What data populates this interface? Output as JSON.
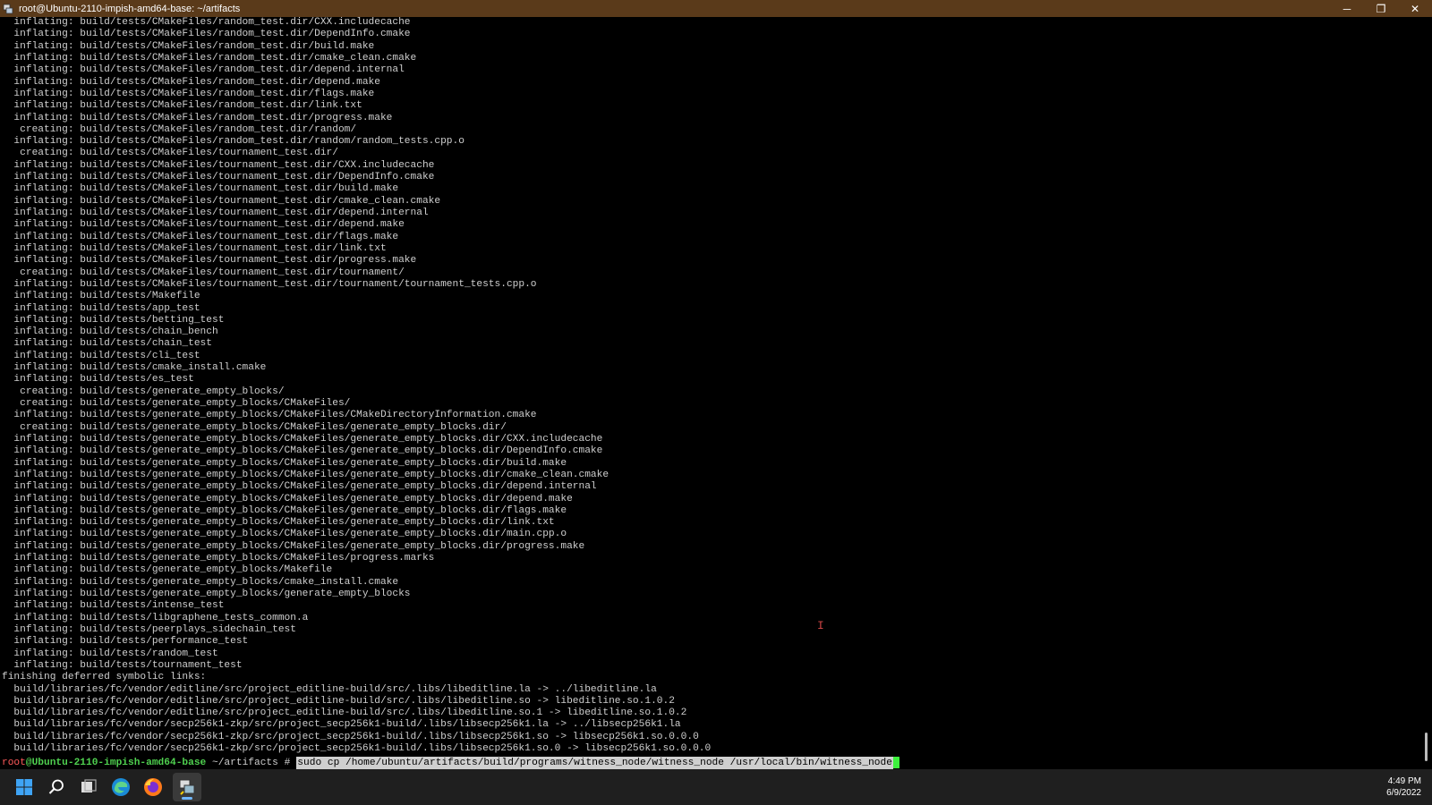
{
  "window": {
    "title": "root@Ubuntu-2110-impish-amd64-base: ~/artifacts",
    "buttons": {
      "minimize": "─",
      "maximize": "❐",
      "close": "✕"
    }
  },
  "terminal": {
    "lines": [
      "  inflating: build/tests/CMakeFiles/random_test.dir/CXX.includecache",
      "  inflating: build/tests/CMakeFiles/random_test.dir/DependInfo.cmake",
      "  inflating: build/tests/CMakeFiles/random_test.dir/build.make",
      "  inflating: build/tests/CMakeFiles/random_test.dir/cmake_clean.cmake",
      "  inflating: build/tests/CMakeFiles/random_test.dir/depend.internal",
      "  inflating: build/tests/CMakeFiles/random_test.dir/depend.make",
      "  inflating: build/tests/CMakeFiles/random_test.dir/flags.make",
      "  inflating: build/tests/CMakeFiles/random_test.dir/link.txt",
      "  inflating: build/tests/CMakeFiles/random_test.dir/progress.make",
      "   creating: build/tests/CMakeFiles/random_test.dir/random/",
      "  inflating: build/tests/CMakeFiles/random_test.dir/random/random_tests.cpp.o",
      "   creating: build/tests/CMakeFiles/tournament_test.dir/",
      "  inflating: build/tests/CMakeFiles/tournament_test.dir/CXX.includecache",
      "  inflating: build/tests/CMakeFiles/tournament_test.dir/DependInfo.cmake",
      "  inflating: build/tests/CMakeFiles/tournament_test.dir/build.make",
      "  inflating: build/tests/CMakeFiles/tournament_test.dir/cmake_clean.cmake",
      "  inflating: build/tests/CMakeFiles/tournament_test.dir/depend.internal",
      "  inflating: build/tests/CMakeFiles/tournament_test.dir/depend.make",
      "  inflating: build/tests/CMakeFiles/tournament_test.dir/flags.make",
      "  inflating: build/tests/CMakeFiles/tournament_test.dir/link.txt",
      "  inflating: build/tests/CMakeFiles/tournament_test.dir/progress.make",
      "   creating: build/tests/CMakeFiles/tournament_test.dir/tournament/",
      "  inflating: build/tests/CMakeFiles/tournament_test.dir/tournament/tournament_tests.cpp.o",
      "  inflating: build/tests/Makefile",
      "  inflating: build/tests/app_test",
      "  inflating: build/tests/betting_test",
      "  inflating: build/tests/chain_bench",
      "  inflating: build/tests/chain_test",
      "  inflating: build/tests/cli_test",
      "  inflating: build/tests/cmake_install.cmake",
      "  inflating: build/tests/es_test",
      "   creating: build/tests/generate_empty_blocks/",
      "   creating: build/tests/generate_empty_blocks/CMakeFiles/",
      "  inflating: build/tests/generate_empty_blocks/CMakeFiles/CMakeDirectoryInformation.cmake",
      "   creating: build/tests/generate_empty_blocks/CMakeFiles/generate_empty_blocks.dir/",
      "  inflating: build/tests/generate_empty_blocks/CMakeFiles/generate_empty_blocks.dir/CXX.includecache",
      "  inflating: build/tests/generate_empty_blocks/CMakeFiles/generate_empty_blocks.dir/DependInfo.cmake",
      "  inflating: build/tests/generate_empty_blocks/CMakeFiles/generate_empty_blocks.dir/build.make",
      "  inflating: build/tests/generate_empty_blocks/CMakeFiles/generate_empty_blocks.dir/cmake_clean.cmake",
      "  inflating: build/tests/generate_empty_blocks/CMakeFiles/generate_empty_blocks.dir/depend.internal",
      "  inflating: build/tests/generate_empty_blocks/CMakeFiles/generate_empty_blocks.dir/depend.make",
      "  inflating: build/tests/generate_empty_blocks/CMakeFiles/generate_empty_blocks.dir/flags.make",
      "  inflating: build/tests/generate_empty_blocks/CMakeFiles/generate_empty_blocks.dir/link.txt",
      "  inflating: build/tests/generate_empty_blocks/CMakeFiles/generate_empty_blocks.dir/main.cpp.o",
      "  inflating: build/tests/generate_empty_blocks/CMakeFiles/generate_empty_blocks.dir/progress.make",
      "  inflating: build/tests/generate_empty_blocks/CMakeFiles/progress.marks",
      "  inflating: build/tests/generate_empty_blocks/Makefile",
      "  inflating: build/tests/generate_empty_blocks/cmake_install.cmake",
      "  inflating: build/tests/generate_empty_blocks/generate_empty_blocks",
      "  inflating: build/tests/intense_test",
      "  inflating: build/tests/libgraphene_tests_common.a",
      "  inflating: build/tests/peerplays_sidechain_test",
      "  inflating: build/tests/performance_test",
      "  inflating: build/tests/random_test",
      "  inflating: build/tests/tournament_test",
      "finishing deferred symbolic links:",
      "  build/libraries/fc/vendor/editline/src/project_editline-build/src/.libs/libeditline.la -> ../libeditline.la",
      "  build/libraries/fc/vendor/editline/src/project_editline-build/src/.libs/libeditline.so -> libeditline.so.1.0.2",
      "  build/libraries/fc/vendor/editline/src/project_editline-build/src/.libs/libeditline.so.1 -> libeditline.so.1.0.2",
      "  build/libraries/fc/vendor/secp256k1-zkp/src/project_secp256k1-build/.libs/libsecp256k1.la -> ../libsecp256k1.la",
      "  build/libraries/fc/vendor/secp256k1-zkp/src/project_secp256k1-build/.libs/libsecp256k1.so -> libsecp256k1.so.0.0.0",
      "  build/libraries/fc/vendor/secp256k1-zkp/src/project_secp256k1-build/.libs/libsecp256k1.so.0 -> libsecp256k1.so.0.0.0"
    ],
    "prompt": {
      "user": "root",
      "host": "@Ubuntu-2110-impish-amd64-base",
      "path": " ~/artifacts",
      "symbol": " #",
      "command": "sudo cp /home/ubuntu/artifacts/build/programs/witness_node/witness_node /usr/local/bin/witness_node"
    }
  },
  "taskbar": {
    "icons": [
      "windows-start-icon",
      "search-icon",
      "task-view-icon",
      "edge-icon",
      "firefox-icon",
      "putty-icon"
    ],
    "time": "4:49 PM",
    "date": "6/9/2022"
  },
  "colors": {
    "titlebar": "#5a3a1a",
    "prompt_user": "#ff5a5a",
    "prompt_host": "#4fd14f",
    "cursor": "#3cf03c",
    "taskbar": "#1f1f1f"
  }
}
